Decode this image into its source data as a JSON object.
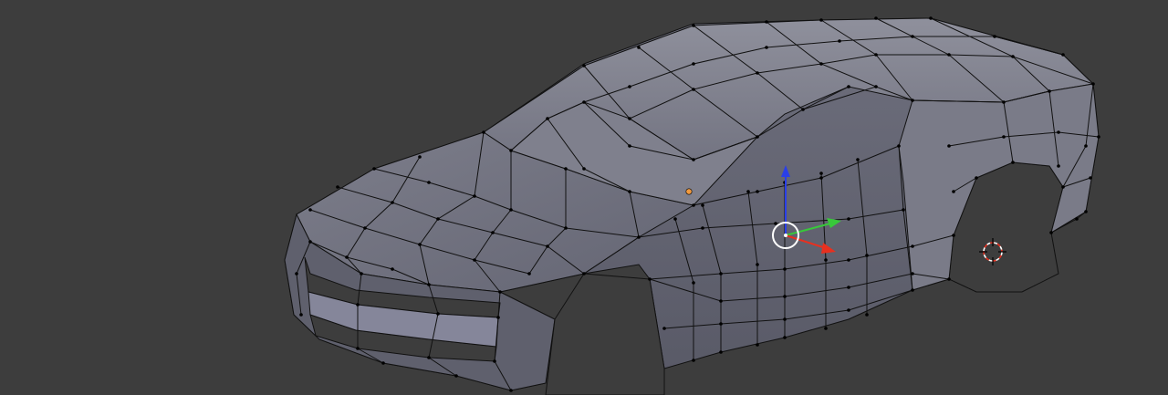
{
  "app": {
    "name": "",
    "mode": "edit-mode"
  },
  "viewport": {
    "background_color": "#3d3d3d",
    "mesh_face_color": "#6b6c7a",
    "mesh_face_light_color": "#8a8b97",
    "mesh_face_dark_color": "#4d4e59",
    "mesh_edge_color": "#111111",
    "vertex_color": "#000000",
    "origin_color": "#f29a3e"
  },
  "manipulator": {
    "x_axis_color": "#e8301f",
    "y_axis_color": "#38c83a",
    "z_axis_color": "#2a3fe8",
    "center_ring_color": "#ffffff"
  },
  "cursor_3d": {
    "ring_color_a": "#e8301f",
    "ring_color_b": "#ffffff",
    "crosshair_color": "#000000"
  },
  "icons": [
    "mesh-object",
    "object-origin-dot",
    "transform-manipulator",
    "3d-cursor-icon"
  ]
}
